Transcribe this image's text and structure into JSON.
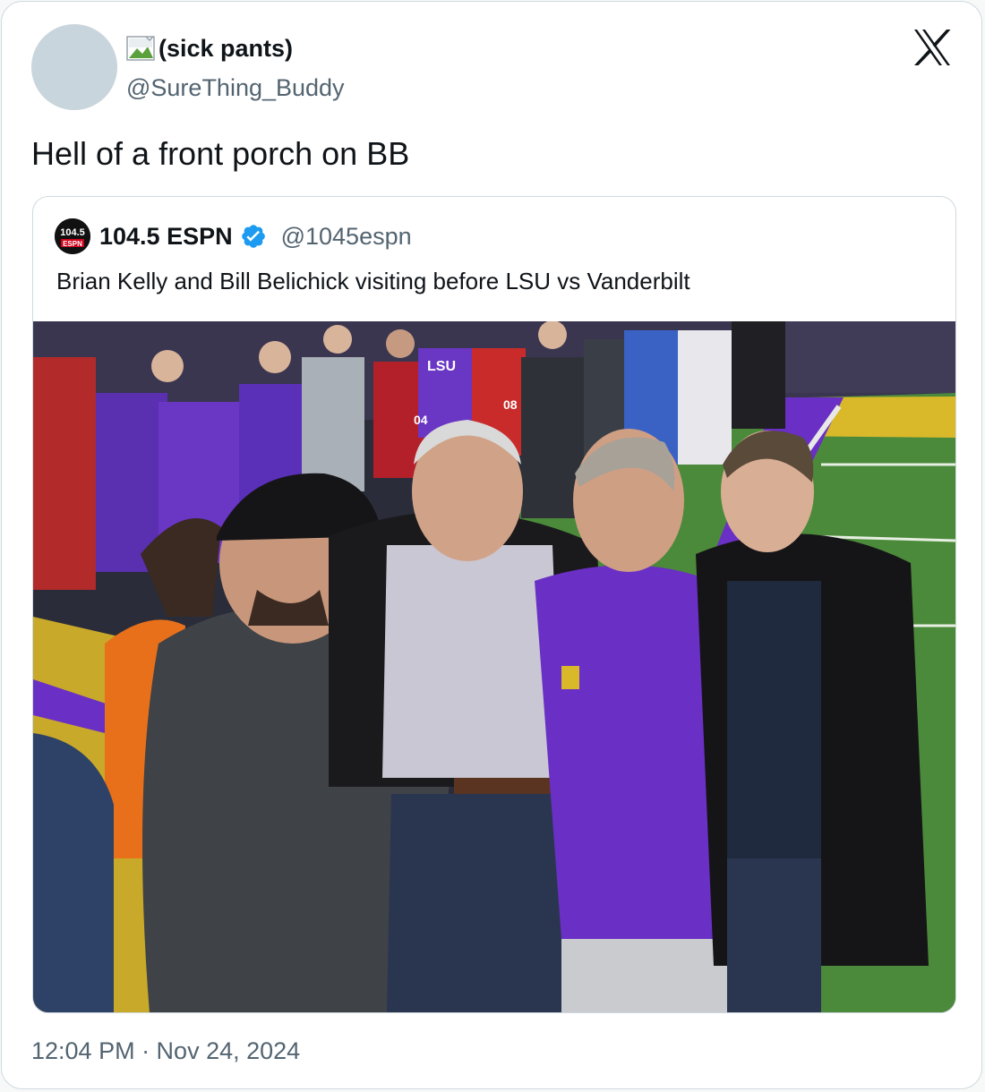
{
  "tweet": {
    "display_name": "(sick pants)",
    "handle": "@SureThing_Buddy",
    "text": "Hell of a front porch on BB",
    "timestamp": "12:04 PM · Nov 24, 2024",
    "logo_icon": "x-logo-icon"
  },
  "quoted_tweet": {
    "display_name": "104.5 ESPN",
    "handle": "@1045espn",
    "text": "Brian Kelly and Bill Belichick visiting before LSU vs Vanderbilt",
    "verified": true,
    "avatar_text": "104.5",
    "avatar_subtext": "ESPN"
  },
  "photo": {
    "jersey_text_1": "04",
    "jersey_text_2": "08",
    "banner_text": "LSU"
  },
  "colors": {
    "verified_blue": "#1d9bf0",
    "lsu_purple": "#6a2fc4",
    "turf_green": "#4b8a3a",
    "end_zone_yellow": "#d9b92a"
  }
}
